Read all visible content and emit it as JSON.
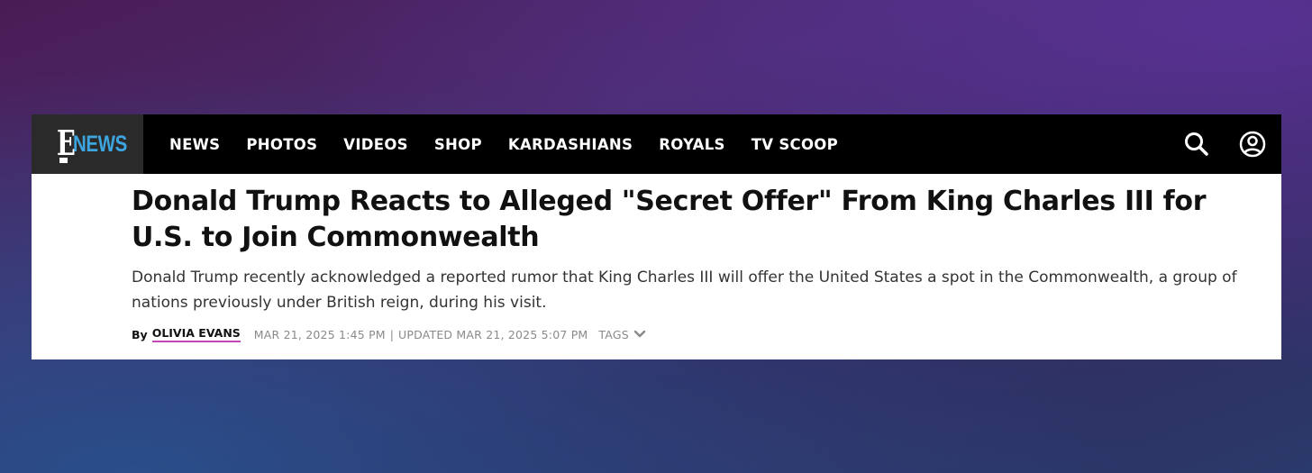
{
  "brand": {
    "logo_letter": "E",
    "logo_word": "NEWS",
    "accent_color": "#3da5e0",
    "author_underline_color": "#c246b8"
  },
  "nav": {
    "items": [
      {
        "label": "NEWS"
      },
      {
        "label": "PHOTOS"
      },
      {
        "label": "VIDEOS"
      },
      {
        "label": "SHOP"
      },
      {
        "label": "KARDASHIANS"
      },
      {
        "label": "ROYALS"
      },
      {
        "label": "TV SCOOP"
      }
    ],
    "search_icon": "search-icon",
    "account_icon": "user-account-icon"
  },
  "article": {
    "headline": "Donald Trump Reacts to Alleged \"Secret Offer\" From King Charles III for U.S. to Join Commonwealth",
    "dek": "Donald Trump recently acknowledged a reported rumor that King Charles III will offer the United States a spot in the Commonwealth, a group of nations previously under British reign, during his visit.",
    "byline": {
      "prefix": "By",
      "author": "OLIVIA EVANS",
      "published": "MAR 21, 2025 1:45 PM",
      "separator": "|",
      "updated": "UPDATED MAR 21, 2025 5:07 PM",
      "tags_label": "TAGS"
    }
  }
}
